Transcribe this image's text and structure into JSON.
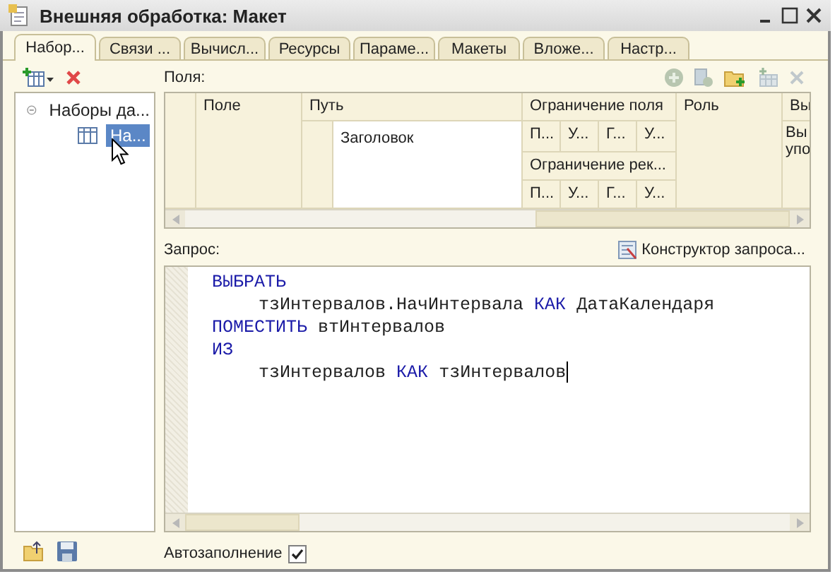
{
  "window": {
    "title": "Внешняя обработка: Макет"
  },
  "tabs": [
    {
      "label": "Набор...",
      "selected": true
    },
    {
      "label": "Связи ...",
      "selected": false
    },
    {
      "label": "Вычисл...",
      "selected": false
    },
    {
      "label": "Ресурсы",
      "selected": false
    },
    {
      "label": "Параме...",
      "selected": false
    },
    {
      "label": "Макеты",
      "selected": false
    },
    {
      "label": "Вложе...",
      "selected": false
    },
    {
      "label": "Настр...",
      "selected": false
    }
  ],
  "tree": {
    "items": [
      {
        "label": "Наборы да...",
        "expanded": true,
        "selected": false,
        "children": [
          {
            "label": "На...",
            "selected": true
          }
        ]
      }
    ]
  },
  "fields": {
    "label": "Поля:",
    "columns": {
      "field": "Поле",
      "path": "Путь",
      "field_restriction": "Ограничение поля",
      "attr_restriction": "Ограничение рек...",
      "role": "Роль",
      "column_6": "Вы"
    },
    "restriction_flags": [
      "П...",
      "У...",
      "Г...",
      "У..."
    ],
    "attr_restriction_flags": [
      "П...",
      "У...",
      "Г...",
      "У..."
    ],
    "row": {
      "path": "Заголовок",
      "column_6": "Вы упо"
    }
  },
  "query": {
    "label": "Запрос:",
    "designer": "Конструктор запроса...",
    "caret_at_end": true,
    "lines": [
      {
        "kind": "clause",
        "tokens": [
          {
            "kind": "keyword",
            "text": "ВЫБРАТЬ"
          }
        ]
      },
      {
        "kind": "body",
        "tokens": [
          {
            "kind": "plain",
            "text": "тзИнтервалов.НачИнтервала"
          },
          {
            "kind": "keyword",
            "text": "КАК"
          },
          {
            "kind": "plain",
            "text": "ДатаКалендаря"
          }
        ]
      },
      {
        "kind": "clause",
        "tokens": [
          {
            "kind": "keyword",
            "text": "ПОМЕСТИТЬ"
          },
          {
            "kind": "plain",
            "text": "втИнтервалов"
          }
        ]
      },
      {
        "kind": "clause",
        "tokens": [
          {
            "kind": "keyword",
            "text": "ИЗ"
          }
        ]
      },
      {
        "kind": "body",
        "tokens": [
          {
            "kind": "plain",
            "text": "тзИнтервалов"
          },
          {
            "kind": "keyword",
            "text": "КАК"
          },
          {
            "kind": "plain",
            "text": "тзИнтервалов"
          }
        ]
      }
    ]
  },
  "autofill": {
    "label": "Автозаполнение",
    "checked": true
  }
}
